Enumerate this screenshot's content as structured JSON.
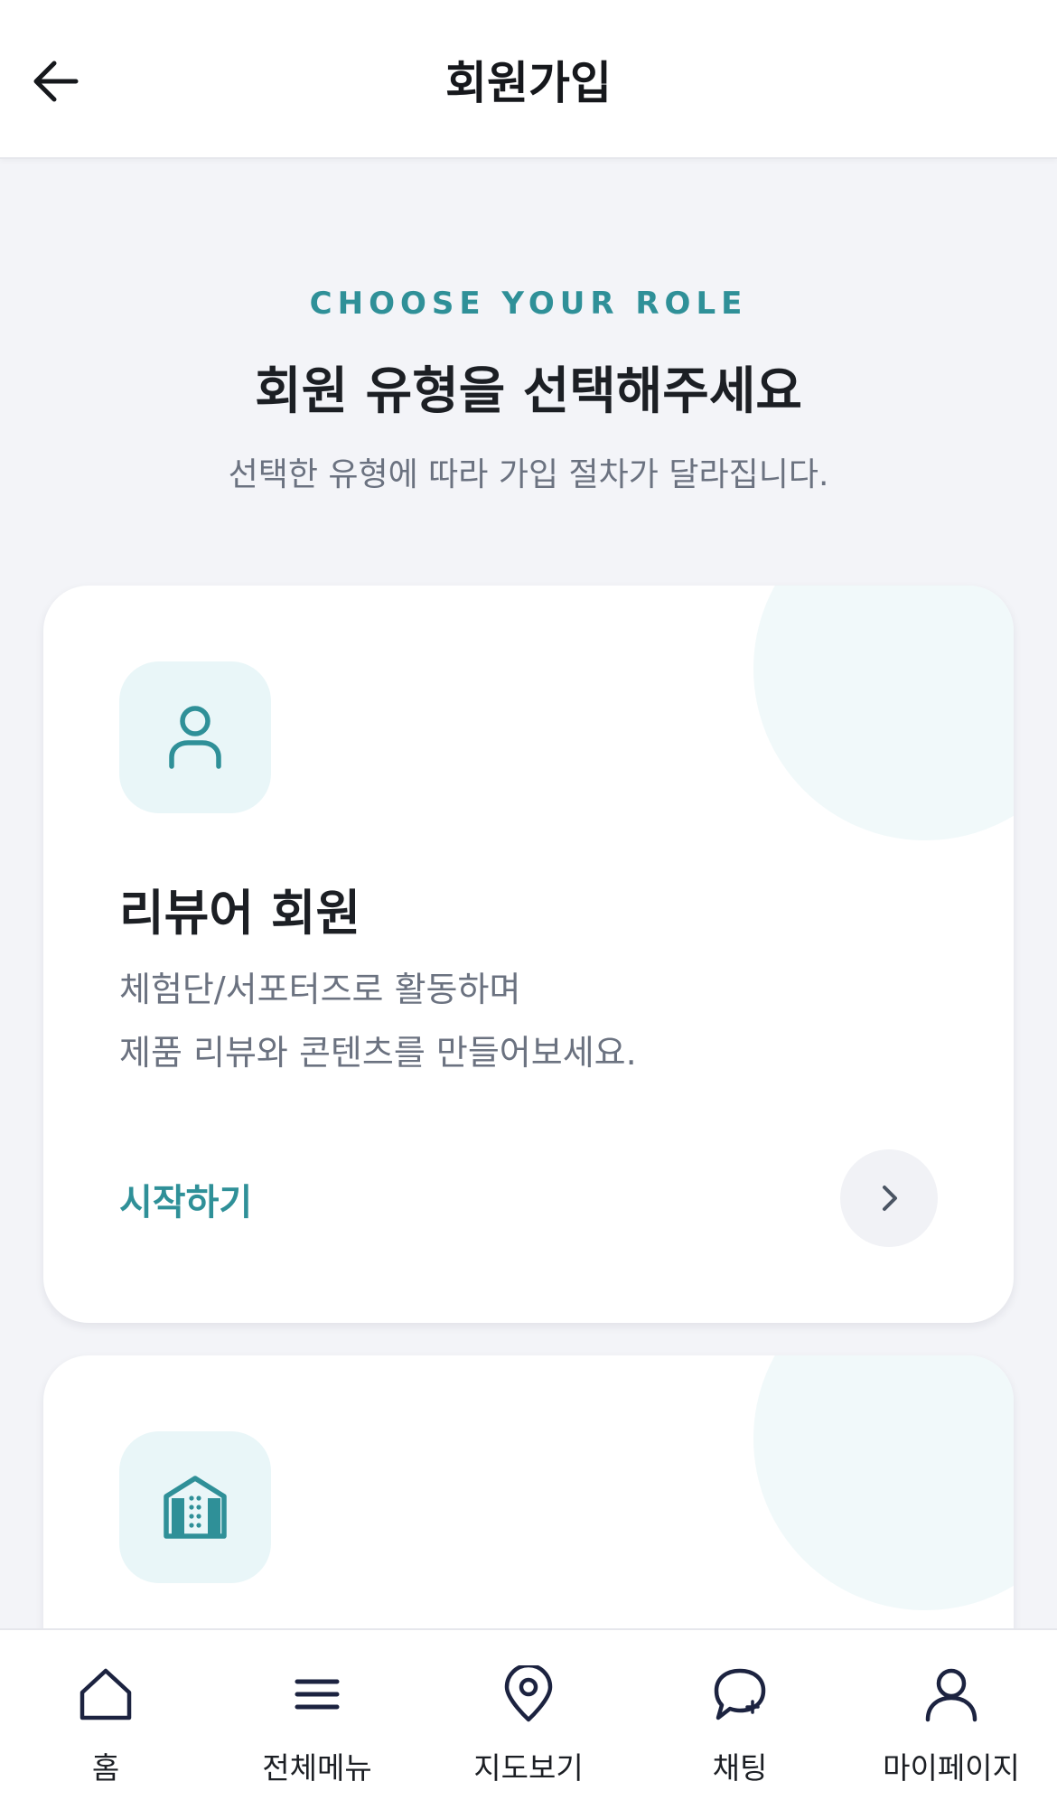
{
  "header": {
    "title": "회원가입"
  },
  "intro": {
    "eyebrow": "CHOOSE YOUR ROLE",
    "title": "회원 유형을 선택해주세요",
    "subtitle": "선택한 유형에 따라 가입 절차가 달라집니다."
  },
  "cards": [
    {
      "icon": "user-icon",
      "title": "리뷰어 회원",
      "desc_line1": "체험단/서포터즈로 활동하며",
      "desc_line2": "제품 리뷰와 콘텐츠를 만들어보세요.",
      "cta": "시작하기"
    },
    {
      "icon": "building-icon"
    }
  ],
  "nav": [
    {
      "label": "홈",
      "icon": "home-icon"
    },
    {
      "label": "전체메뉴",
      "icon": "menu-icon"
    },
    {
      "label": "지도보기",
      "icon": "map-pin-icon"
    },
    {
      "label": "채팅",
      "icon": "chat-icon"
    },
    {
      "label": "마이페이지",
      "icon": "person-icon"
    }
  ],
  "colors": {
    "accent": "#2f9098",
    "icon_bg": "#e9f6f8",
    "background": "#f3f4f8",
    "nav_icon": "#1c2340"
  }
}
